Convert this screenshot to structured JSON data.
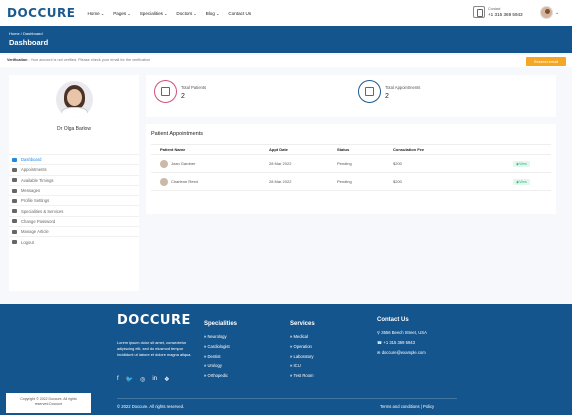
{
  "header": {
    "logo": "DOCCURE",
    "nav": [
      "Home",
      "Pages",
      "Specialities",
      "Doctors",
      "Blog",
      "Contact Us"
    ],
    "contact_label": "Contact",
    "contact_phone": "+1 315 369 5943"
  },
  "breadcrumb": {
    "path": "Home / Dashboard",
    "title": "Dashboard"
  },
  "verify": {
    "label": "Verification",
    "message": " : Your account is not verified. Please check your email for the verification",
    "button": "Resend email"
  },
  "profile": {
    "name": "Dr Olga Barlow"
  },
  "menu": [
    {
      "label": "Dashboard",
      "icon": "dashboard-icon",
      "active": true
    },
    {
      "label": "Appointments",
      "icon": "calendar-icon"
    },
    {
      "label": "Available Timings",
      "icon": "clock-icon"
    },
    {
      "label": "Messages",
      "icon": "comments-icon"
    },
    {
      "label": "Profile Settings",
      "icon": "user-cog-icon"
    },
    {
      "label": "Specialities & Services",
      "icon": "file-icon"
    },
    {
      "label": "Change Password",
      "icon": "lock-icon"
    },
    {
      "label": "Manage Article",
      "icon": "pen-icon"
    },
    {
      "label": "Logout",
      "icon": "sign-out-icon"
    }
  ],
  "stats": [
    {
      "label": "Total Patients",
      "value": "2",
      "icon": "patients-icon"
    },
    {
      "label": "Total Appointments",
      "value": "2",
      "icon": "appointments-icon"
    }
  ],
  "appointments": {
    "title": "Patient Appointments",
    "headers": [
      "Patient Name",
      "Appt Date",
      "Status",
      "Consulation Fee",
      ""
    ],
    "rows": [
      {
        "name": "Joan Gardner",
        "date": "28 Mar 2022",
        "status": "Pending",
        "fee": "$200",
        "action": "View"
      },
      {
        "name": "Charlene Reed",
        "date": "28 Mar 2022",
        "status": "Pending",
        "fee": "$200",
        "action": "View"
      }
    ]
  },
  "footer": {
    "logo": "DOCCURE",
    "about": "Lorem ipsum dolor sit amet, consectetur adipiscing elit, sed do eiusmod tempor incididunt ut labore et dolore magna aliqua.",
    "social": [
      "f",
      "🐦",
      "◎",
      "in",
      "❖"
    ],
    "specialities": {
      "title": "Specialities",
      "items": [
        "Neurology",
        "Cardiologist",
        "Dentist",
        "Urology",
        "Orthopedic"
      ]
    },
    "services": {
      "title": "Services",
      "items": [
        "Medical",
        "Operation",
        "Laboratory",
        "ICU",
        "Test Room"
      ]
    },
    "contact": {
      "title": "Contact Us",
      "address": "3556 Beech Street, USA",
      "phone": "+1 315 369 5943",
      "email": "doccure@example.com"
    },
    "rights": "© 2022 Doccure. All rights reserved.",
    "terms": "Terms and conditions  |  Policy",
    "copyright_box": "Copyright © 2022 Doccure. All rights reserved.Doccure"
  },
  "colors": {
    "primary": "#15558d",
    "accent": "#e9425b",
    "active": "#1e88e5",
    "warn": "#f5a623"
  }
}
